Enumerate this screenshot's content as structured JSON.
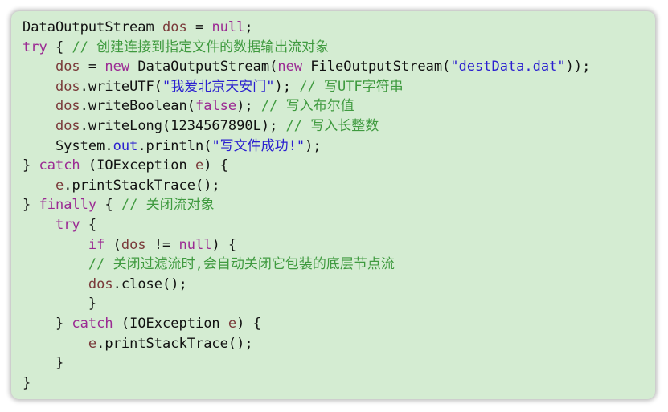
{
  "code_lines": [
    [
      {
        "t": "DataOutputStream ",
        "c": "pl"
      },
      {
        "t": "dos",
        "c": "vr"
      },
      {
        "t": " = ",
        "c": "pl"
      },
      {
        "t": "null",
        "c": "kw"
      },
      {
        "t": ";",
        "c": "pl"
      }
    ],
    [
      {
        "t": "try",
        "c": "kw"
      },
      {
        "t": " { ",
        "c": "pl"
      },
      {
        "t": "// 创建连接到指定文件的数据输出流对象",
        "c": "cm"
      }
    ],
    [
      {
        "t": "    ",
        "c": "pl"
      },
      {
        "t": "dos",
        "c": "vr"
      },
      {
        "t": " = ",
        "c": "pl"
      },
      {
        "t": "new",
        "c": "kw"
      },
      {
        "t": " DataOutputStream(",
        "c": "pl"
      },
      {
        "t": "new",
        "c": "kw"
      },
      {
        "t": " FileOutputStream(",
        "c": "pl"
      },
      {
        "t": "\"destData.dat\"",
        "c": "st"
      },
      {
        "t": "));",
        "c": "pl"
      }
    ],
    [
      {
        "t": "    ",
        "c": "pl"
      },
      {
        "t": "dos",
        "c": "vr"
      },
      {
        "t": ".writeUTF(",
        "c": "pl"
      },
      {
        "t": "\"我爱北京天安门\"",
        "c": "st"
      },
      {
        "t": "); ",
        "c": "pl"
      },
      {
        "t": "// 写UTF字符串",
        "c": "cm"
      }
    ],
    [
      {
        "t": "    ",
        "c": "pl"
      },
      {
        "t": "dos",
        "c": "vr"
      },
      {
        "t": ".writeBoolean(",
        "c": "pl"
      },
      {
        "t": "false",
        "c": "kw"
      },
      {
        "t": "); ",
        "c": "pl"
      },
      {
        "t": "// 写入布尔值",
        "c": "cm"
      }
    ],
    [
      {
        "t": "    ",
        "c": "pl"
      },
      {
        "t": "dos",
        "c": "vr"
      },
      {
        "t": ".writeLong(1234567890L); ",
        "c": "pl"
      },
      {
        "t": "// 写入长整数",
        "c": "cm"
      }
    ],
    [
      {
        "t": "    System.",
        "c": "pl"
      },
      {
        "t": "out",
        "c": "st"
      },
      {
        "t": ".println(",
        "c": "pl"
      },
      {
        "t": "\"写文件成功!\"",
        "c": "st"
      },
      {
        "t": ");",
        "c": "pl"
      }
    ],
    [
      {
        "t": "} ",
        "c": "pl"
      },
      {
        "t": "catch",
        "c": "kw"
      },
      {
        "t": " (IOException ",
        "c": "pl"
      },
      {
        "t": "e",
        "c": "vr"
      },
      {
        "t": ") {",
        "c": "pl"
      }
    ],
    [
      {
        "t": "    ",
        "c": "pl"
      },
      {
        "t": "e",
        "c": "vr"
      },
      {
        "t": ".printStackTrace();",
        "c": "pl"
      }
    ],
    [
      {
        "t": "} ",
        "c": "pl"
      },
      {
        "t": "finally",
        "c": "kw"
      },
      {
        "t": " { ",
        "c": "pl"
      },
      {
        "t": "// 关闭流对象",
        "c": "cm"
      }
    ],
    [
      {
        "t": "    ",
        "c": "pl"
      },
      {
        "t": "try",
        "c": "kw"
      },
      {
        "t": " {",
        "c": "pl"
      }
    ],
    [
      {
        "t": "        ",
        "c": "pl"
      },
      {
        "t": "if",
        "c": "kw"
      },
      {
        "t": " (",
        "c": "pl"
      },
      {
        "t": "dos",
        "c": "vr"
      },
      {
        "t": " != ",
        "c": "pl"
      },
      {
        "t": "null",
        "c": "kw"
      },
      {
        "t": ") {",
        "c": "pl"
      }
    ],
    [
      {
        "t": "        ",
        "c": "pl"
      },
      {
        "t": "// 关闭过滤流时,会自动关闭它包装的底层节点流",
        "c": "cm"
      }
    ],
    [
      {
        "t": "        ",
        "c": "pl"
      },
      {
        "t": "dos",
        "c": "vr"
      },
      {
        "t": ".close();",
        "c": "pl"
      }
    ],
    [
      {
        "t": "        }",
        "c": "pl"
      }
    ],
    [
      {
        "t": "    } ",
        "c": "pl"
      },
      {
        "t": "catch",
        "c": "kw"
      },
      {
        "t": " (IOException ",
        "c": "pl"
      },
      {
        "t": "e",
        "c": "vr"
      },
      {
        "t": ") {",
        "c": "pl"
      }
    ],
    [
      {
        "t": "        ",
        "c": "pl"
      },
      {
        "t": "e",
        "c": "vr"
      },
      {
        "t": ".printStackTrace();",
        "c": "pl"
      }
    ],
    [
      {
        "t": "    }",
        "c": "pl"
      }
    ],
    [
      {
        "t": "}",
        "c": "pl"
      }
    ]
  ],
  "colors": {
    "panel_background": "#d4ecd2",
    "plain": "#111111",
    "keyword": "#9b2a93",
    "comment": "#3f9a3f",
    "string": "#2a1fd0",
    "variable": "#7a3a3a"
  }
}
